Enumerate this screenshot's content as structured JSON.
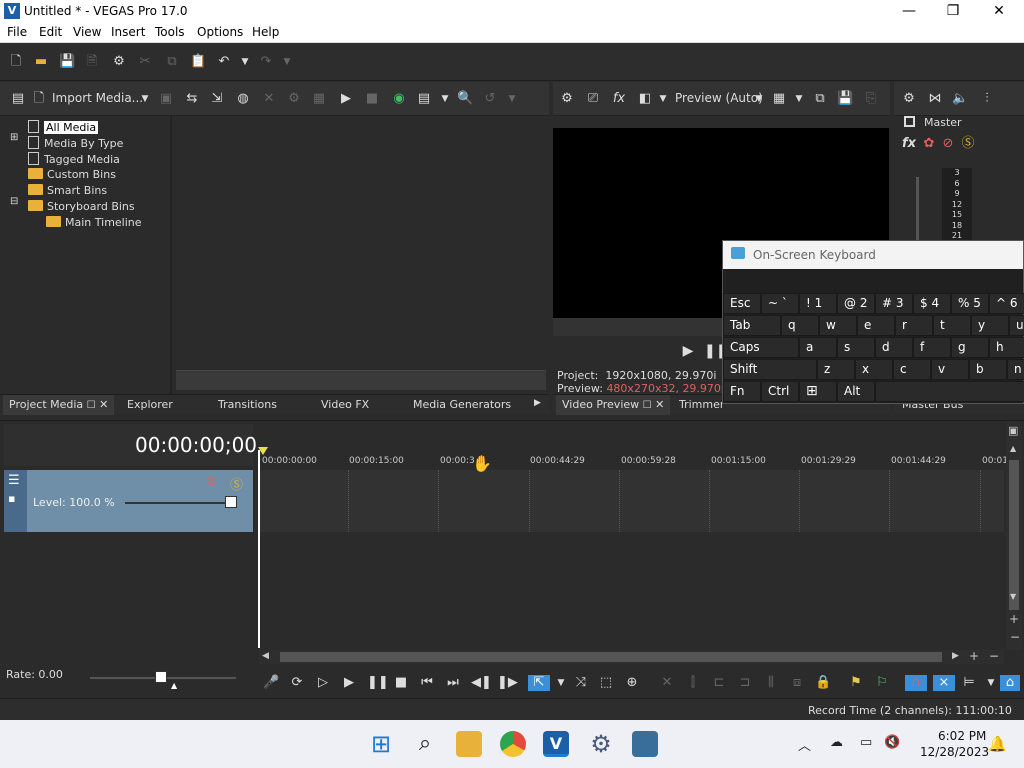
{
  "window": {
    "title": "Untitled * - VEGAS Pro 17.0",
    "logo_letter": "V",
    "minimize": "—",
    "maximize": "❐",
    "close": "✕"
  },
  "menu": [
    "File",
    "Edit",
    "View",
    "Insert",
    "Tools",
    "Options",
    "Help"
  ],
  "project_media": {
    "import_label": "Import Media...",
    "tree": [
      "All Media",
      "Media By Type",
      "Tagged Media",
      "Custom Bins",
      "Smart Bins",
      "Storyboard Bins",
      "Main Timeline"
    ]
  },
  "preview": {
    "mode_label": "Preview (Auto)",
    "project_label": "Project:",
    "project_value": "1920x1080, 29.970i",
    "preview_label": "Preview:",
    "preview_value": "480x270x32, 29.970p"
  },
  "master": {
    "label": "Master",
    "scale": [
      "3",
      "6",
      "9",
      "12",
      "15",
      "18",
      "21"
    ]
  },
  "tabs": {
    "project_media": "Project Media",
    "explorer": "Explorer",
    "transitions": "Transitions",
    "video_fx": "Video FX",
    "media_generators": "Media Generators",
    "video_preview": "Video Preview",
    "trimmer": "Trimmer",
    "master_bus": "Master Bus"
  },
  "keyboard": {
    "title": "On-Screen Keyboard",
    "row1": [
      "Esc",
      "~ `",
      "! 1",
      "@ 2",
      "# 3",
      "$ 4",
      "% 5",
      "^ 6"
    ],
    "row2": [
      "Tab",
      "q",
      "w",
      "e",
      "r",
      "t",
      "y",
      "u"
    ],
    "row3": [
      "Caps",
      "a",
      "s",
      "d",
      "f",
      "g",
      "h"
    ],
    "row4": [
      "Shift",
      "z",
      "x",
      "c",
      "v",
      "b",
      "n"
    ],
    "row5": [
      "Fn",
      "Ctrl",
      "Alt"
    ]
  },
  "timeline": {
    "timecode": "00:00:00;00",
    "track_level": "Level: 100.0 %",
    "rate": "Rate: 0.00",
    "ruler": [
      "00:00:00:00",
      "00:00:15:00",
      "00:00:3",
      "00:00:44:29",
      "00:00:59:28",
      "00:01:15:00",
      "00:01:29:29",
      "00:01:44:29",
      "00:01"
    ]
  },
  "status": {
    "record_time": "Record Time (2 channels): 111:00:10"
  },
  "taskbar": {
    "time": "6:02 PM",
    "date": "12/28/2023"
  }
}
